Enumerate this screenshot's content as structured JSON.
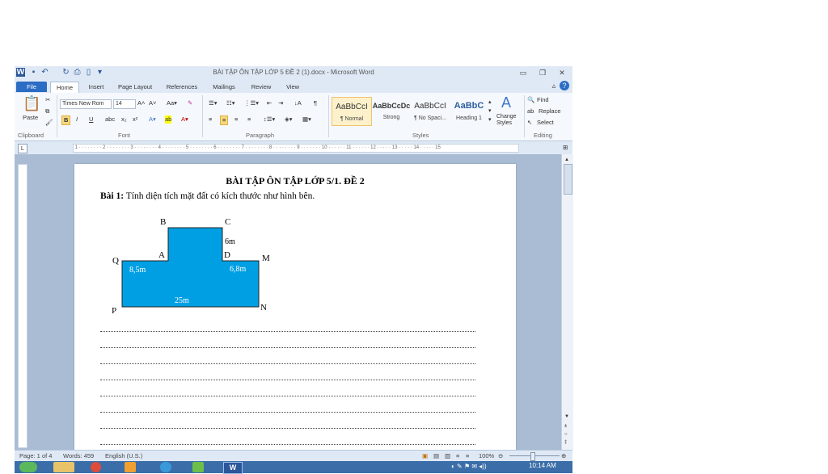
{
  "window": {
    "title": "BÀI TẬP ÔN TẬP LỚP 5 ĐỀ 2 (1).docx - Microsoft Word"
  },
  "tabs": [
    "File",
    "Home",
    "Insert",
    "Page Layout",
    "References",
    "Mailings",
    "Review",
    "View"
  ],
  "ribbon": {
    "clipboard": {
      "paste": "Paste",
      "label": "Clipboard"
    },
    "font": {
      "name": "Times New Rom",
      "size": "14",
      "label": "Font",
      "bold": "B",
      "italic": "I",
      "underline": "U"
    },
    "paragraph": {
      "label": "Paragraph"
    },
    "styles": {
      "label": "Styles",
      "items": [
        {
          "sample": "AaBbCcI",
          "name": "¶ Normal"
        },
        {
          "sample": "AaBbCcDc",
          "name": "Strong"
        },
        {
          "sample": "AaBbCcI",
          "name": "¶ No Spaci..."
        },
        {
          "sample": "AaBbC",
          "name": "Heading 1"
        }
      ],
      "change_styles": "Change Styles"
    },
    "editing": {
      "label": "Editing",
      "find": "Find",
      "replace": "Replace",
      "select": "Select"
    }
  },
  "document": {
    "heading": "BÀI TẬP ÔN TẬP LỚP 5/1. ĐỀ 2",
    "bai1_label": "Bài 1:",
    "bai1_text": " Tính diện tích mặt đất có kích thước như hình bên.",
    "figure": {
      "labels": {
        "B": "B",
        "C": "C",
        "A": "A",
        "D": "D",
        "Q": "Q",
        "M": "M",
        "P": "P",
        "N": "N"
      },
      "measures": {
        "cd": "6m",
        "qa": "8,5m",
        "dm": "6,8m",
        "pn": "25m"
      },
      "fill_color": "#009fe3"
    },
    "dotted_line_count": 8
  },
  "status": {
    "page": "Page: 1 of 4",
    "words": "Words: 459",
    "language": "English (U.S.)",
    "zoom": "100%"
  },
  "taskbar": {
    "time": "10:14 AM"
  }
}
